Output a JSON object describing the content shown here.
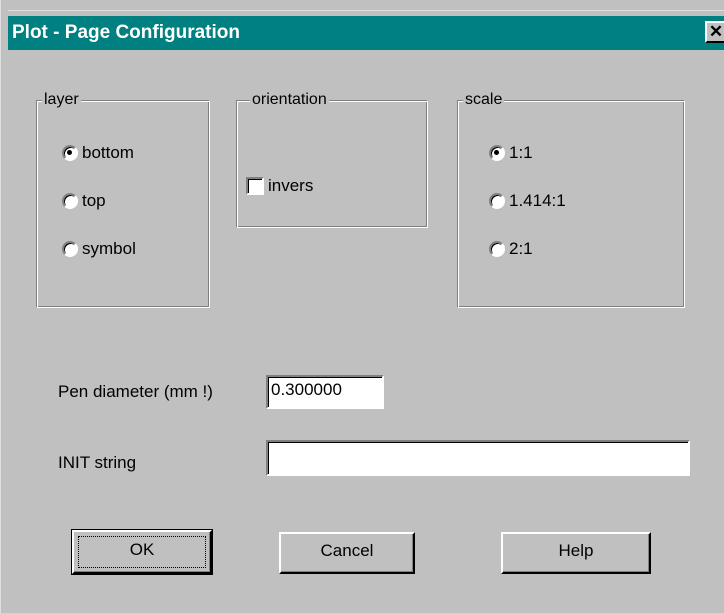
{
  "window": {
    "title": "Plot - Page Configuration",
    "close_glyph": "✕"
  },
  "layer": {
    "legend": "layer",
    "options": [
      {
        "label": "bottom",
        "checked": true
      },
      {
        "label": "top",
        "checked": false
      },
      {
        "label": "symbol",
        "checked": false
      }
    ]
  },
  "orientation": {
    "legend": "orientation",
    "invers_label": "invers",
    "invers_checked": false
  },
  "scale": {
    "legend": "scale",
    "options": [
      {
        "label": "1:1",
        "checked": true
      },
      {
        "label": "1.414:1",
        "checked": false
      },
      {
        "label": "2:1",
        "checked": false
      }
    ]
  },
  "pen": {
    "label": "Pen diameter (mm !)",
    "value": "0.300000"
  },
  "init": {
    "label": "INIT string",
    "value": ""
  },
  "buttons": {
    "ok": "OK",
    "cancel": "Cancel",
    "help": "Help"
  },
  "colors": {
    "titlebar": "#008080",
    "dialog": "#c0c0c0"
  }
}
